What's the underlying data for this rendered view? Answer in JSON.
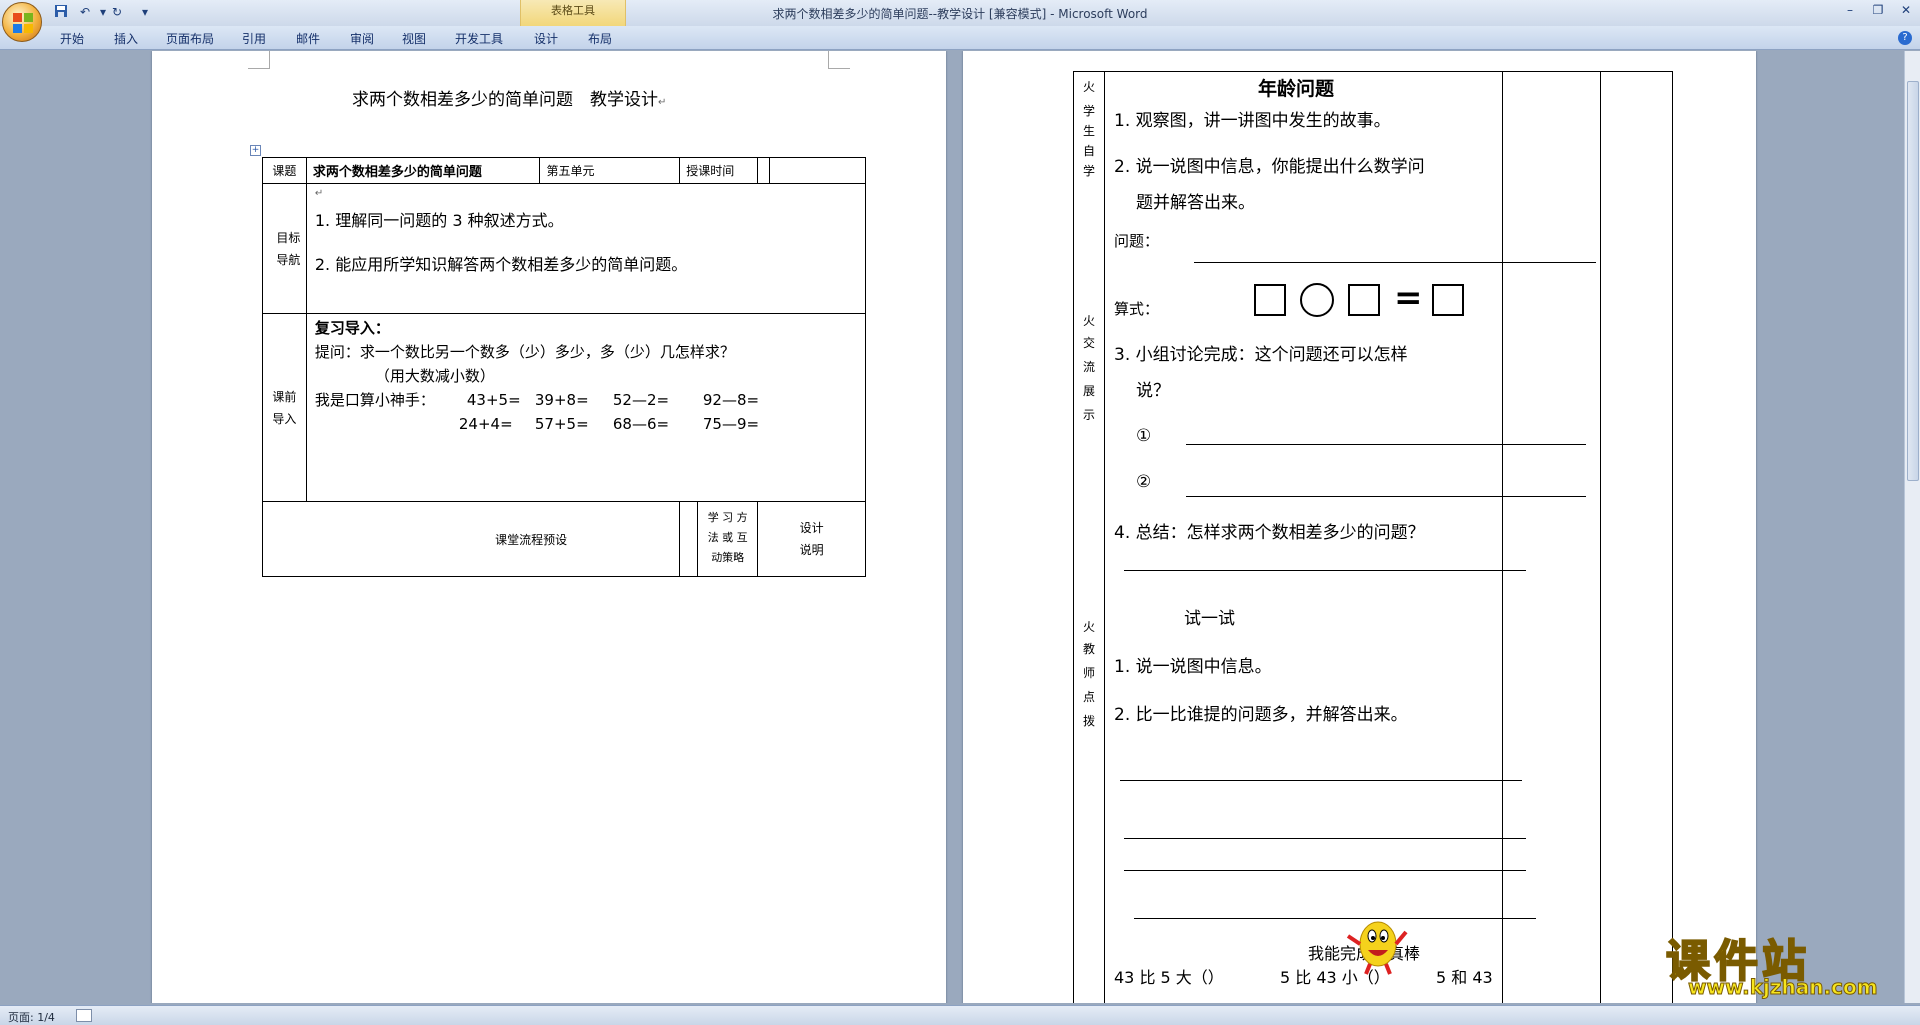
{
  "window": {
    "title": "求两个数相差多少的简单问题--教学设计 [兼容模式] - Microsoft Word",
    "context_tab": "表格工具",
    "quick_access": [
      "save-icon",
      "undo-icon",
      "redo-icon",
      "customize-icon"
    ]
  },
  "ribbon": {
    "tabs": [
      "开始",
      "插入",
      "页面布局",
      "引用",
      "邮件",
      "审阅",
      "视图",
      "开发工具",
      "设计",
      "布局"
    ]
  },
  "page1": {
    "title": "求两个数相差多少的简单问题　教学设计",
    "header_row": {
      "topic_label": "课题",
      "topic_value": "求两个数相差多少的简单问题",
      "unit": "第五单元",
      "time_label": "授课时间"
    },
    "goals": {
      "label_1": "目标",
      "label_2": "导航",
      "items": [
        "1. 理解同一问题的 3 种叙述方式。",
        "2. 能应用所学知识解答两个数相差多少的简单问题。"
      ]
    },
    "intro": {
      "label_1": "课前",
      "label_2": "导入",
      "heading": "复习导入：",
      "question": "提问：求一个数比另一个数多（少）多少，多（少）几怎样求？",
      "hint": "（用大数减小数）",
      "drill_label": "我是口算小神手：",
      "row1": [
        "43+5=",
        "39+8=",
        "52—2=",
        "92—8="
      ],
      "row2": [
        "24+4=",
        "57+5=",
        "68—6=",
        "75—9="
      ]
    },
    "flow": {
      "label": "课堂流程预设",
      "method_1": "学 习 方",
      "method_2": "法 或 互",
      "method_3": "动策略",
      "design_1": "设计",
      "design_2": "说明"
    }
  },
  "page2": {
    "side_sections": [
      [
        "火",
        "学",
        "生",
        "自",
        "学"
      ],
      [
        "火",
        "交",
        "流",
        "展",
        "示"
      ],
      [
        "火",
        "教",
        "师",
        "点",
        "拨"
      ]
    ],
    "heading": "年龄问题",
    "items": {
      "q1": "1. 观察图，讲一讲图中发生的故事。",
      "q2a": "2. 说一说图中信息，你能提出什么数学问",
      "q2b": "题并解答出来。",
      "problem_label": "问题：",
      "formula_label": "算式：",
      "q3a": "3. 小组讨论完成：这个问题还可以怎样",
      "q3b": "说？",
      "circ1": "①",
      "circ2": "②",
      "q4": "4. 总结：怎样求两个数相差多少的问题？",
      "try_heading": "试一试",
      "t1": "1. 说一说图中信息。",
      "t2": "2. 比一比谁提的问题多，并解答出来。",
      "cheer": "我能完成我真棒",
      "bottom_a": "43 比 5 大（）",
      "bottom_b": "5 比 43 小（）",
      "bottom_c": "5 和 43"
    }
  },
  "statusbar": {
    "page_info": "页面: 1/4"
  },
  "watermark": {
    "main": "课件站",
    "url": "www.kjzhan.com"
  }
}
